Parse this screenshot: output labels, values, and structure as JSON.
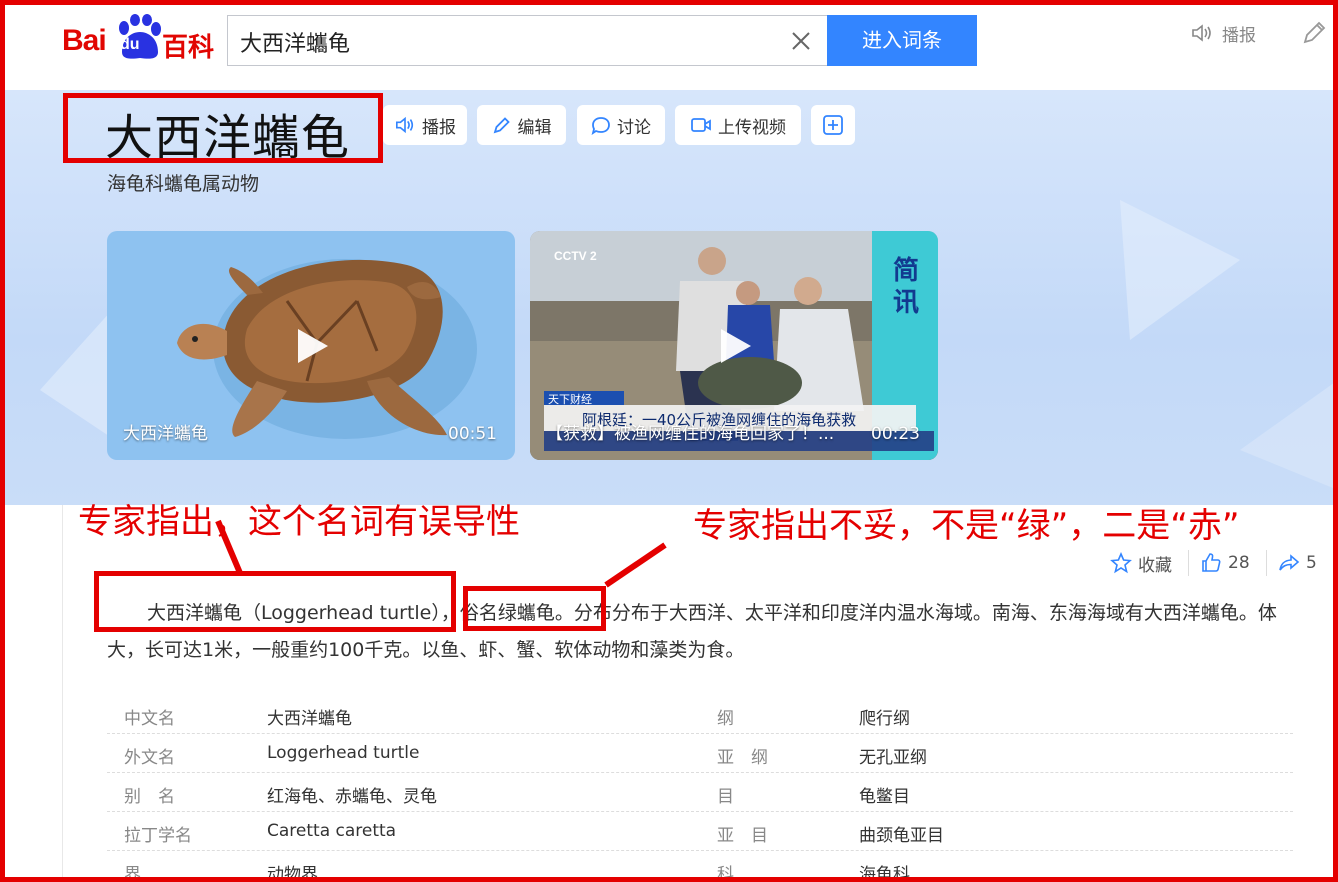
{
  "header": {
    "logo_text": "Baidu百科",
    "search_value": "大西洋蠵龟",
    "enter_button": "进入词条",
    "audio_label": "播报"
  },
  "entry": {
    "title": "大西洋蠵龟",
    "subtitle": "海龟科蠵龟属动物",
    "actions": [
      {
        "label": "播报",
        "icon": "speaker-icon"
      },
      {
        "label": "编辑",
        "icon": "pencil-icon"
      },
      {
        "label": "讨论",
        "icon": "chat-bubble-icon"
      },
      {
        "label": "上传视频",
        "icon": "video-camera-icon"
      }
    ]
  },
  "videos": [
    {
      "title": "大西洋蠵龟",
      "duration": "00:51"
    },
    {
      "title": "【获救】被渔网缠住的海龟回家了！...",
      "duration": "00:23",
      "ticker_tag": "天下财经",
      "ticker_headline": "阿根廷：一40公斤被渔网缠住的海龟获救",
      "side_caption": "简讯",
      "channel": "CCTV 2"
    }
  ],
  "stats": {
    "collect_label": "收藏",
    "like_count": "28",
    "share_count": "5"
  },
  "summary": {
    "part1": "大西洋蠵龟（Loggerhead turtle），",
    "part2": "俗名绿蠵龟。",
    "part3": "分布分布于大西洋、太平洋和印度洋内温水海域。南海、东海海域有大西洋蠵龟。体大，长可达1米，一般重约100千克。以鱼、虾、蟹、软体动物和藻类为食。"
  },
  "basic_info": [
    {
      "k1": "中文名",
      "v1": "大西洋蠵龟",
      "k2": "纲",
      "v2": "爬行纲"
    },
    {
      "k1": "外文名",
      "v1": "Loggerhead turtle",
      "k2": "亚　纲",
      "v2": "无孔亚纲"
    },
    {
      "k1": "别　名",
      "v1": "红海龟、赤蠵龟、灵龟",
      "k2": "目",
      "v2": "龟鳖目"
    },
    {
      "k1": "拉丁学名",
      "v1": "Caretta caretta",
      "k2": "亚　目",
      "v2": "曲颈龟亚目"
    },
    {
      "k1": "界",
      "v1": "动物界",
      "k2": "科",
      "v2": "海龟科"
    }
  ],
  "annotations": {
    "left": "专家指出，这个名词有误导性",
    "right": "专家指出不妥，不是“绿”，二是“赤”",
    "color": "#e40000"
  }
}
